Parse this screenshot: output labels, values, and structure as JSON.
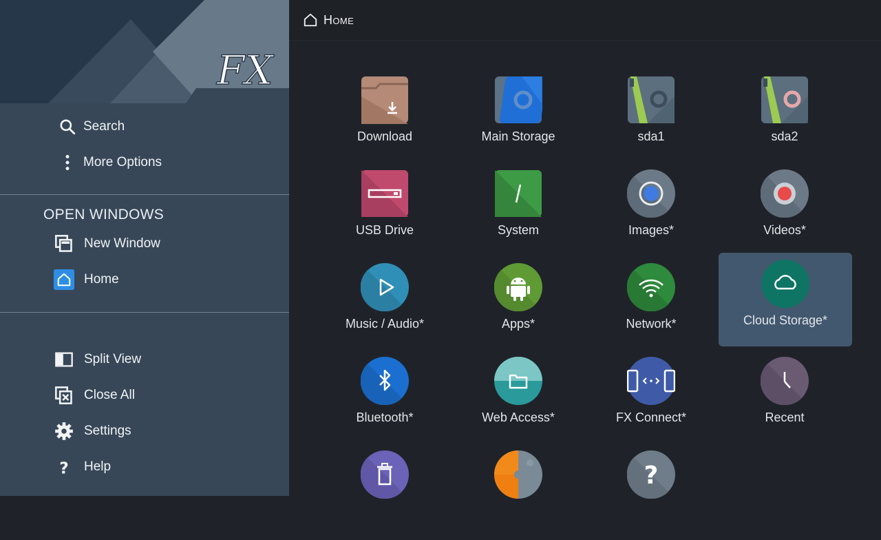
{
  "sidebar": {
    "search_label": "Search",
    "more_options_label": "More Options",
    "open_windows_title": "OPEN WINDOWS",
    "new_window_label": "New Window",
    "home_label": "Home",
    "split_view_label": "Split View",
    "close_all_label": "Close All",
    "settings_label": "Settings",
    "help_label": "Help",
    "logo_text": "FX"
  },
  "header": {
    "title": "Home"
  },
  "tiles": [
    {
      "label": "Download",
      "icon": "download-folder-icon",
      "color": "#b58a77"
    },
    {
      "label": "Main Storage",
      "icon": "main-storage-icon",
      "color": "#1f6fd6"
    },
    {
      "label": "sda1",
      "icon": "sd-card-icon",
      "color": "#5c6f7f"
    },
    {
      "label": "sda2",
      "icon": "sd-card-icon",
      "color": "#5c6f7f"
    },
    {
      "label": "USB Drive",
      "icon": "usb-drive-icon",
      "color": "#c04a6d"
    },
    {
      "label": "System",
      "icon": "system-icon",
      "color": "#3d9a45"
    },
    {
      "label": "Images*",
      "icon": "images-icon",
      "color": "#6c7a88"
    },
    {
      "label": "Videos*",
      "icon": "videos-icon",
      "color": "#6c7a88"
    },
    {
      "label": "Music / Audio*",
      "icon": "music-icon",
      "color": "#2f8fb7"
    },
    {
      "label": "Apps*",
      "icon": "android-icon",
      "color": "#5f9a35"
    },
    {
      "label": "Network*",
      "icon": "wifi-icon",
      "color": "#2e8a3c"
    },
    {
      "label": "Cloud Storage*",
      "icon": "cloud-icon",
      "color": "#0e7464",
      "selected": true
    },
    {
      "label": "Bluetooth*",
      "icon": "bluetooth-icon",
      "color": "#1b6fd0"
    },
    {
      "label": "Web Access*",
      "icon": "web-folder-icon",
      "color": "#2a9a9a"
    },
    {
      "label": "FX Connect*",
      "icon": "fx-connect-icon",
      "color": "#3f5ba8"
    },
    {
      "label": "Recent",
      "icon": "clock-icon",
      "color": "#6a5b73"
    },
    {
      "label": "",
      "icon": "trash-icon",
      "color": "#6b63b7"
    },
    {
      "label": "",
      "icon": "puzzle-icon",
      "color": "#7a8a97"
    },
    {
      "label": "",
      "icon": "question-icon",
      "color": "#6f7d8a"
    }
  ]
}
